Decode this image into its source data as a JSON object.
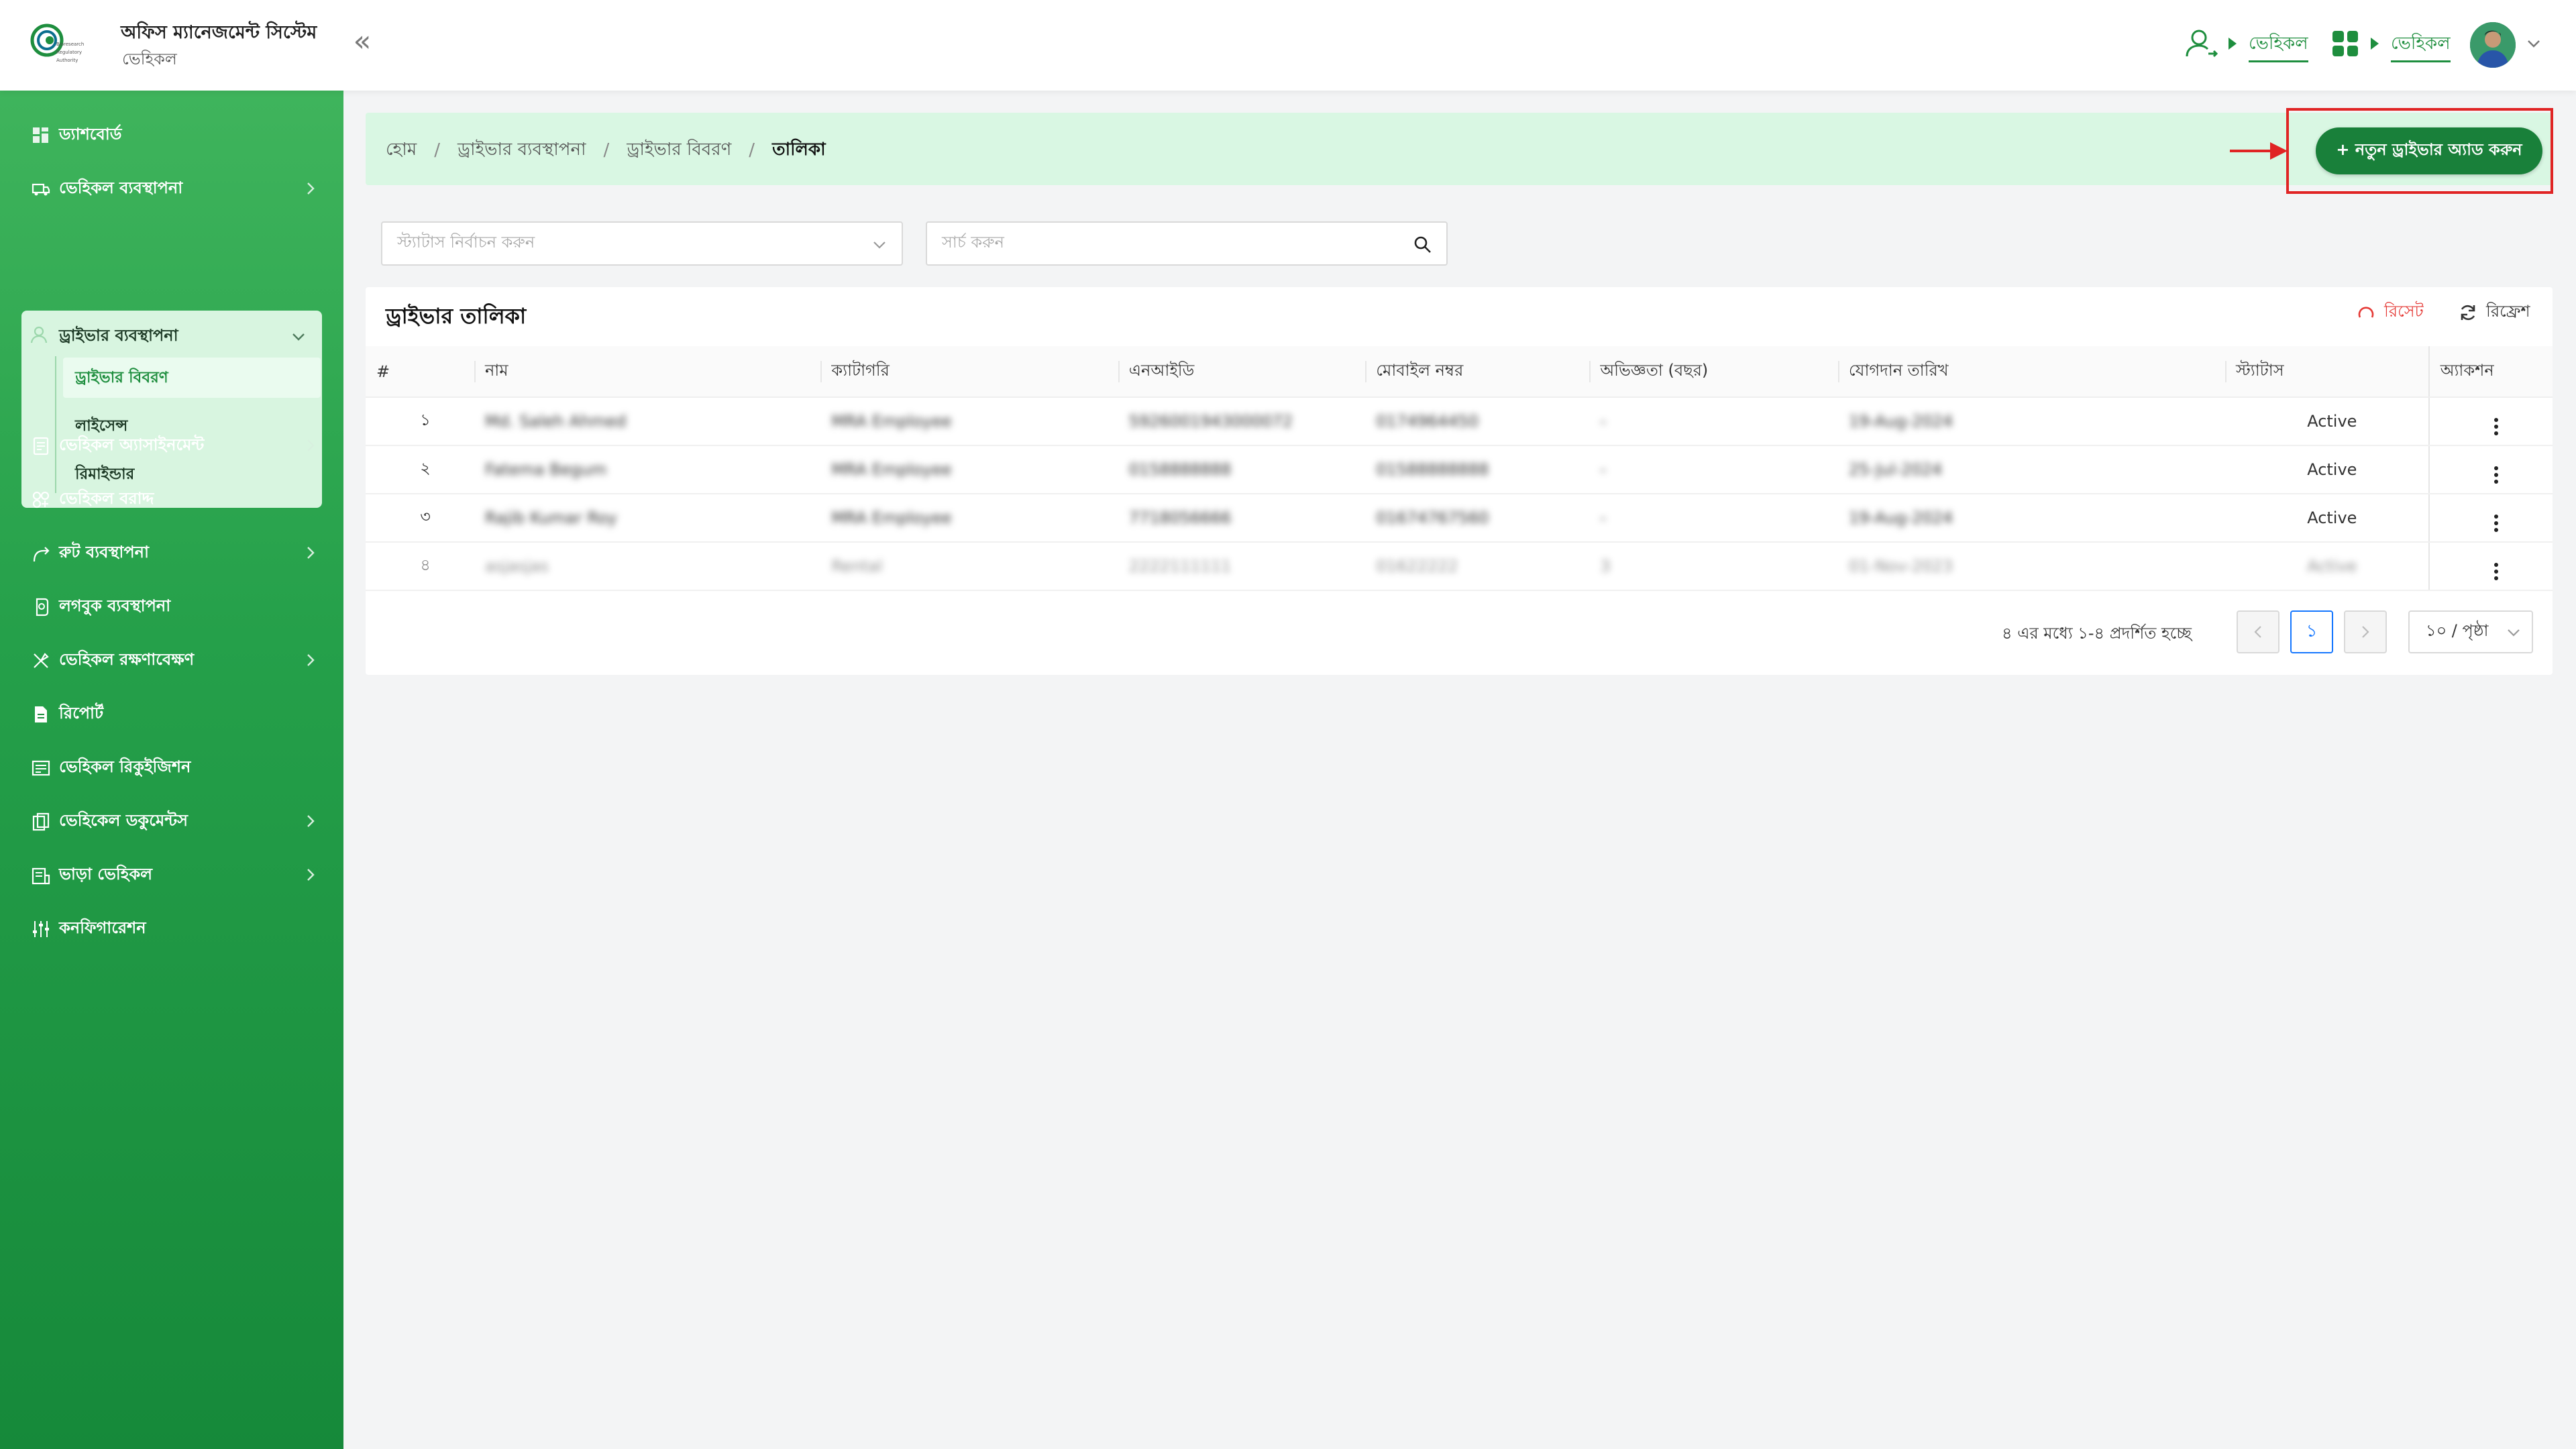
{
  "app": {
    "title": "অফিস ম্যানেজমেন্ট সিস্টেম",
    "subtitle": "ভেহিকল",
    "logo_text": "Bioresearch Regulatory Authority"
  },
  "header": {
    "link_user": "ভেহিকল",
    "link_apps": "ভেহিকল"
  },
  "sidebar": {
    "items": [
      {
        "label": "ড্যাশবোর্ড",
        "icon": "dashboard-icon"
      },
      {
        "label": "ভেহিকল ব্যবস্থাপনা",
        "icon": "car-icon"
      },
      {
        "label": "ড্রাইভার ব্যবস্থাপনা",
        "icon": "driver-icon"
      },
      {
        "label": "ভেহিকল অ্যাসাইনমেন্ট",
        "icon": "assignment-icon"
      },
      {
        "label": "ভেহিকল বরাদ্দ",
        "icon": "allocation-icon"
      },
      {
        "label": "রুট ব্যবস্থাপনা",
        "icon": "route-icon"
      },
      {
        "label": "লগবুক ব্যবস্থাপনা",
        "icon": "logbook-icon"
      },
      {
        "label": "ভেহিকল রক্ষণাবেক্ষণ",
        "icon": "maintenance-icon"
      },
      {
        "label": "রিপোর্ট",
        "icon": "report-icon"
      },
      {
        "label": "ভেহিকল রিকুইজিশন",
        "icon": "requisition-icon"
      },
      {
        "label": "ভেহিকেল ডকুমেন্টস",
        "icon": "documents-icon"
      },
      {
        "label": "ভাড়া ভেহিকল",
        "icon": "rental-icon"
      },
      {
        "label": "কনফিগারেশন",
        "icon": "config-icon"
      }
    ],
    "sub_items": [
      {
        "label": "ড্রাইভার বিবরণ"
      },
      {
        "label": "লাইসেন্স"
      },
      {
        "label": "রিমাইন্ডার"
      }
    ]
  },
  "breadcrumb": {
    "items": [
      "হোম",
      "ড্রাইভার ব্যবস্থাপনা",
      "ড্রাইভার বিবরণ",
      "তালিকা"
    ]
  },
  "actions": {
    "add_driver": "+ নতুন ড্রাইভার অ্যাড করুন"
  },
  "filters": {
    "status_placeholder": "স্ট্যাটাস নির্বাচন করুন",
    "search_placeholder": "সার্চ করুন"
  },
  "table": {
    "title": "ড্রাইভার তালিকা",
    "reset": "রিসেট",
    "refresh": "রিফ্রেশ",
    "columns": [
      "#",
      "নাম",
      "ক্যাটাগরি",
      "এনআইডি",
      "মোবাইল নম্বর",
      "অভিজ্ঞতা (বছর)",
      "যোগদান তারিখ",
      "স্ট্যাটাস",
      "অ্যাকশন"
    ],
    "rows": [
      {
        "num": "১",
        "name": "Md. Saleh Ahmed",
        "category": "MRA Employee",
        "nid": "5926001943000072",
        "mobile": "0174964450",
        "experience": "-",
        "join_date": "19-Aug-2024",
        "status": "Active"
      },
      {
        "num": "২",
        "name": "Fatema Begum",
        "category": "MRA Employee",
        "nid": "0158888888",
        "mobile": "01588888888",
        "experience": "-",
        "join_date": "25-Jul-2024",
        "status": "Active"
      },
      {
        "num": "৩",
        "name": "Rajib Kumar Roy",
        "category": "MRA Employee",
        "nid": "7718056666",
        "mobile": "01674767560",
        "experience": "-",
        "join_date": "19-Aug-2024",
        "status": "Active"
      },
      {
        "num": "৪",
        "name": "asjasjas",
        "category": "Rental",
        "nid": "2222111111",
        "mobile": "01622222",
        "experience": "3",
        "join_date": "01-Nov-2023",
        "status": "Active"
      }
    ]
  },
  "pagination": {
    "summary": "৪ এর মধ্যে ১-৪ প্রদর্শিত হচ্ছে",
    "current_page": "১",
    "page_size": "১০ / পৃষ্ঠা"
  },
  "colors": {
    "brand_green": "#1e8e3e",
    "sidebar_top": "#3fb45c",
    "sidebar_bottom": "#16893a",
    "breadcrumb_bg": "#d9f7e3",
    "highlight_red": "#e02424"
  }
}
